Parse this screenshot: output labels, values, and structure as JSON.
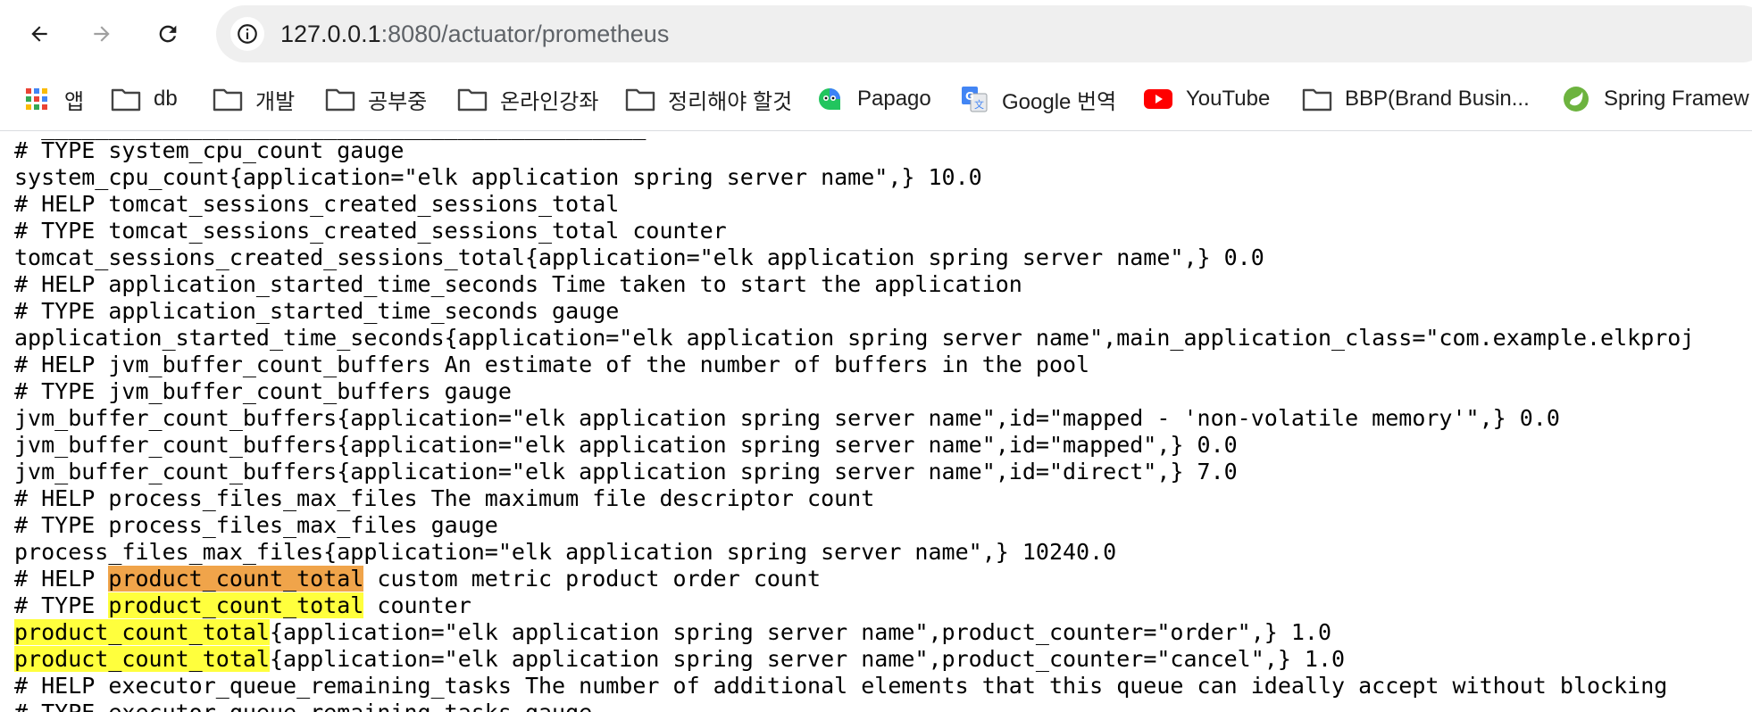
{
  "browser": {
    "url_host": "127.0.0.1",
    "url_rest": ":8080/actuator/prometheus"
  },
  "bookmarks": [
    {
      "label": "앱",
      "icon": "apps-grid-icon"
    },
    {
      "label": "db",
      "icon": "folder-icon"
    },
    {
      "label": "개발",
      "icon": "folder-icon"
    },
    {
      "label": "공부중",
      "icon": "folder-icon"
    },
    {
      "label": "온라인강좌",
      "icon": "folder-icon"
    },
    {
      "label": "정리해야 할것",
      "icon": "folder-icon"
    },
    {
      "label": "Papago",
      "icon": "papago-icon"
    },
    {
      "label": "Google 번역",
      "icon": "google-translate-icon"
    },
    {
      "label": "YouTube",
      "icon": "youtube-icon"
    },
    {
      "label": "BBP(Brand Busin...",
      "icon": "folder-icon"
    },
    {
      "label": "Spring Framew",
      "icon": "spring-icon"
    }
  ],
  "content": {
    "lines": [
      "# TYPE system_cpu_count gauge",
      "system_cpu_count{application=\"elk application spring server name\",} 10.0",
      "# HELP tomcat_sessions_created_sessions_total",
      "# TYPE tomcat_sessions_created_sessions_total counter",
      "tomcat_sessions_created_sessions_total{application=\"elk application spring server name\",} 0.0",
      "# HELP application_started_time_seconds Time taken to start the application",
      "# TYPE application_started_time_seconds gauge",
      "application_started_time_seconds{application=\"elk application spring server name\",main_application_class=\"com.example.elkproj",
      "# HELP jvm_buffer_count_buffers An estimate of the number of buffers in the pool",
      "# TYPE jvm_buffer_count_buffers gauge",
      "jvm_buffer_count_buffers{application=\"elk application spring server name\",id=\"mapped - 'non-volatile memory'\",} 0.0",
      "jvm_buffer_count_buffers{application=\"elk application spring server name\",id=\"mapped\",} 0.0",
      "jvm_buffer_count_buffers{application=\"elk application spring server name\",id=\"direct\",} 7.0",
      "# HELP process_files_max_files The maximum file descriptor count",
      "# TYPE process_files_max_files gauge",
      "process_files_max_files{application=\"elk application spring server name\",} 10240.0"
    ],
    "help_product": {
      "prefix": "# HELP ",
      "term": "product_count_total",
      "rest": " custom metric product order count"
    },
    "type_product": {
      "prefix": "# TYPE ",
      "term": "product_count_total",
      "rest": " counter"
    },
    "product_order": {
      "term": "product_count_total",
      "rest": "{application=\"elk application spring server name\",product_counter=\"order\",} 1.0"
    },
    "product_cancel": {
      "term": "product_count_total",
      "rest": "{application=\"elk application spring server name\",product_counter=\"cancel\",} 1.0"
    },
    "help_executor": "# HELP executor_queue_remaining_tasks The number of additional elements that this queue can ideally accept without blocking",
    "type_executor": "# TYPE executor_queue_remaining_tasks gauge"
  }
}
